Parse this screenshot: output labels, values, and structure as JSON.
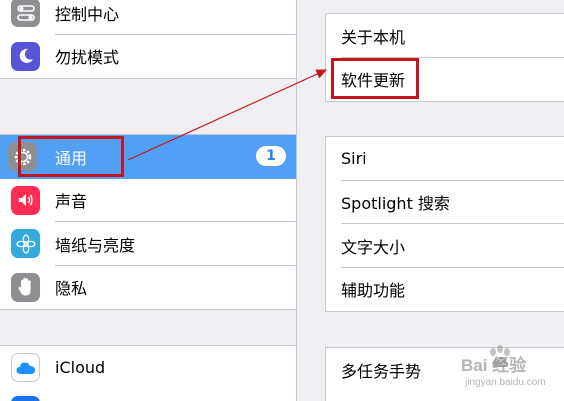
{
  "sidebar": {
    "group1": [
      {
        "label": "控制中心",
        "icon": "control-center-icon"
      },
      {
        "label": "勿扰模式",
        "icon": "moon-icon"
      }
    ],
    "group2": [
      {
        "label": "通用",
        "icon": "gear-icon",
        "badge": "1",
        "selected": true
      },
      {
        "label": "声音",
        "icon": "speaker-icon"
      },
      {
        "label": "墙纸与亮度",
        "icon": "flower-icon"
      },
      {
        "label": "隐私",
        "icon": "hand-icon"
      }
    ],
    "group3": [
      {
        "label": "iCloud",
        "icon": "cloud-icon"
      }
    ]
  },
  "detail": {
    "group1": [
      {
        "label": "关于本机"
      },
      {
        "label": "软件更新"
      }
    ],
    "group2": [
      {
        "label": "Siri"
      },
      {
        "label": "Spotlight 搜索"
      },
      {
        "label": "文字大小"
      },
      {
        "label": "辅助功能"
      }
    ],
    "group3": [
      {
        "label": "多任务手势"
      }
    ]
  },
  "watermark": {
    "brand": "Bai 经验",
    "url": "jingyan.baidu.com"
  },
  "colors": {
    "selected_row": "#52a0f5",
    "annotation_red": "#c4161c",
    "control_center_icon": "#8e8e93",
    "moon_icon": "#5856d6",
    "gear_icon": "#8e8e93",
    "speaker_icon": "#ff2d55",
    "flower_icon": "#34aadc",
    "hand_icon": "#8e8e93",
    "cloud_icon": "#1e90ff"
  }
}
